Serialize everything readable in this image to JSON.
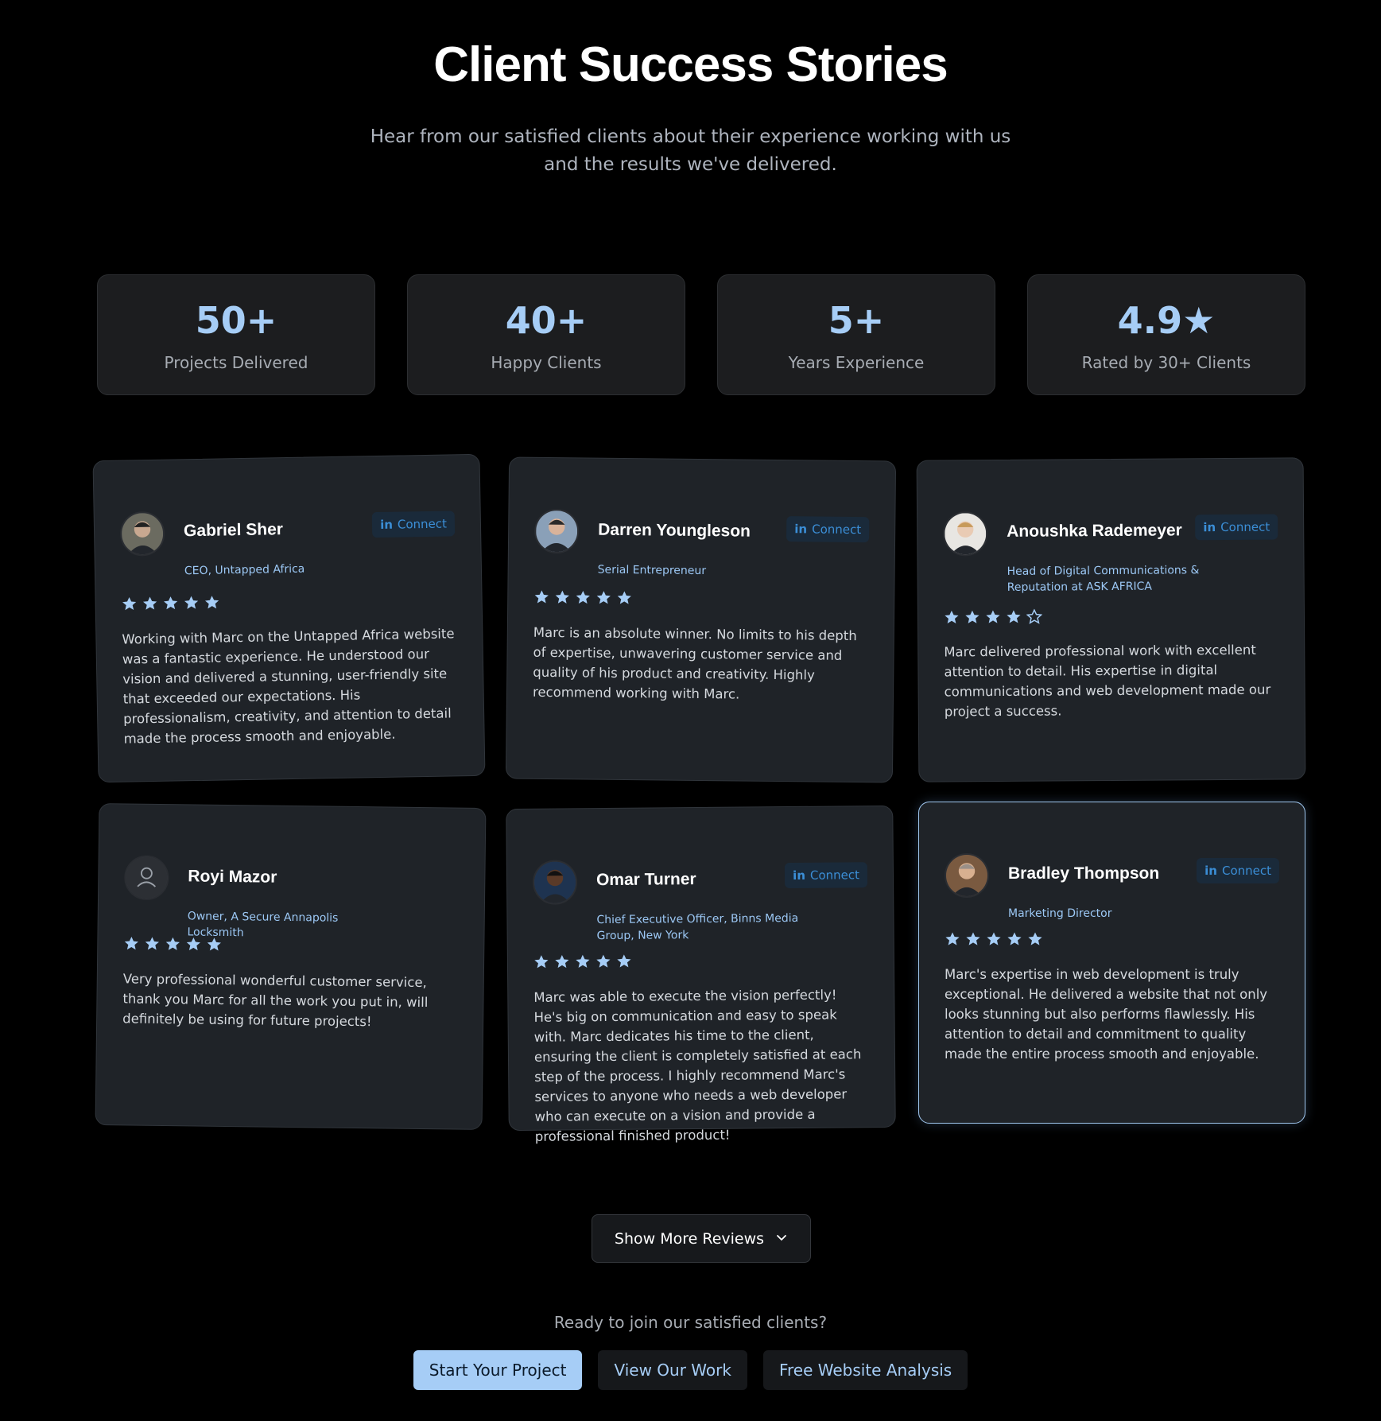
{
  "header": {
    "title": "Client Success Stories",
    "subtitle": "Hear from our satisfied clients about their experience working with us and the results we've delivered."
  },
  "stats": [
    {
      "value": "50+",
      "label": "Projects Delivered"
    },
    {
      "value": "40+",
      "label": "Happy Clients"
    },
    {
      "value": "5+",
      "label": "Years Experience"
    },
    {
      "value": "4.9★",
      "label": "Rated by 30+ Clients"
    }
  ],
  "testimonials": [
    {
      "name": "Gabriel Sher",
      "role": "CEO, Untapped Africa",
      "rating": 5,
      "text": "Working with Marc on the Untapped Africa website was a fantastic experience. He understood our vision and delivered a stunning, user-friendly site that exceeded our expectations. His professionalism, creativity, and attention to detail made the process smooth and enjoyable.",
      "connect": "Connect",
      "avatar": "photo"
    },
    {
      "name": "Darren Youngleson",
      "role": "Serial Entrepreneur",
      "rating": 5,
      "text": "Marc is an absolute winner. No limits to his depth of expertise, unwavering customer service and quality of his product and creativity. Highly recommend working with Marc.",
      "connect": "Connect",
      "avatar": "photo"
    },
    {
      "name": "Anoushka Rademeyer",
      "role": "Head of Digital Communications & Reputation at ASK AFRICA",
      "rating": 4,
      "text": "Marc delivered professional work with excellent attention to detail. His expertise in digital communications and web development made our project a success.",
      "connect": "Connect",
      "avatar": "photo"
    },
    {
      "name": "Royi Mazor",
      "role": "Owner, A Secure Annapolis Locksmith",
      "rating": 5,
      "text": "Very professional wonderful customer service, thank you Marc for all the work you put in, will definitely be using for future projects!",
      "connect": "",
      "avatar": "placeholder"
    },
    {
      "name": "Omar Turner",
      "role": "Chief Executive Officer, Binns Media Group, New York",
      "rating": 5,
      "text": "Marc was able to execute the vision perfectly! He's big on communication and easy to speak with. Marc dedicates his time to the client, ensuring the client is completely satisfied at each step of the process. I highly recommend Marc's services to anyone who needs a web developer who can execute on a vision and provide a professional finished product!",
      "connect": "Connect",
      "avatar": "photo"
    },
    {
      "name": "Bradley Thompson",
      "role": "Marketing Director",
      "rating": 5,
      "text": "Marc's expertise in web development is truly exceptional. He delivered a website that not only looks stunning but also performs flawlessly. His attention to detail and commitment to quality made the entire process smooth and enjoyable.",
      "connect": "Connect",
      "avatar": "photo"
    }
  ],
  "show_more": {
    "label": "Show More Reviews",
    "icon": "chevron-down-icon"
  },
  "cta": {
    "question": "Ready to join our satisfied clients?",
    "primary": "Start Your Project",
    "view_work": "View Our Work",
    "analysis": "Free Website Analysis"
  },
  "colors": {
    "accent": "#a6cdf6",
    "link": "#3b8ed6",
    "card": "#1f2328",
    "star": "#a6cdf6"
  }
}
